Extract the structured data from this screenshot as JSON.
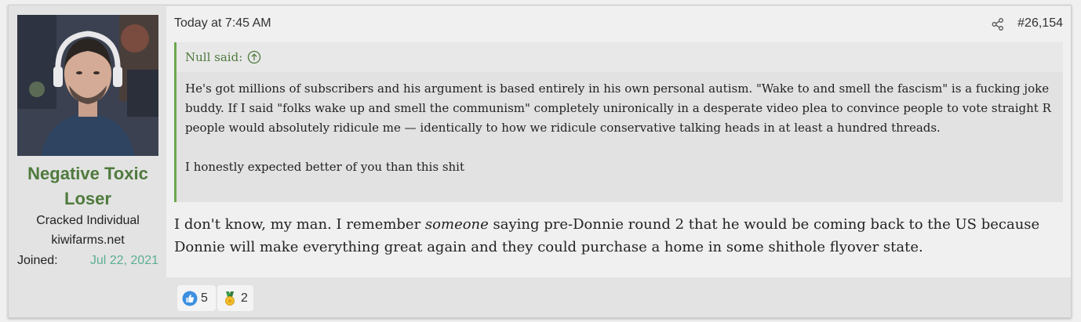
{
  "user": {
    "name": "Negative Toxic Loser",
    "title": "Cracked Individual",
    "site": "kiwifarms.net",
    "joined_label": "Joined:",
    "joined_value": "Jul 22, 2021"
  },
  "post": {
    "timestamp": "Today at 7:45 AM",
    "number": "#26,154"
  },
  "quote": {
    "author": "Null said:",
    "paragraph_1": "He's got millions of subscribers and his argument is based entirely in his own personal autism. \"Wake to and smell the fascism\" is a fucking joke buddy. If I said \"folks wake up and smell the communism\" completely unironically in a desperate video plea to convince people to vote straight R people would absolutely ridicule me — identically to how we ridicule conservative talking heads in at least a hundred threads.",
    "paragraph_2": "I honestly expected better of you than this shit"
  },
  "message": {
    "before": "I don't know, my man. I remember ",
    "emphasis": "someone",
    "after": " saying pre-Donnie round 2 that he would be coming back to the US because Donnie will make everything great again and they could purchase a home in some shithole flyover state."
  },
  "reactions": [
    {
      "icon": "thumbs-up-icon",
      "count": "5"
    },
    {
      "icon": "medal-icon",
      "count": "2"
    }
  ],
  "colors": {
    "username": "#4f7a3d",
    "joined_date": "#5cae94",
    "quote_border": "#6aa84f"
  }
}
